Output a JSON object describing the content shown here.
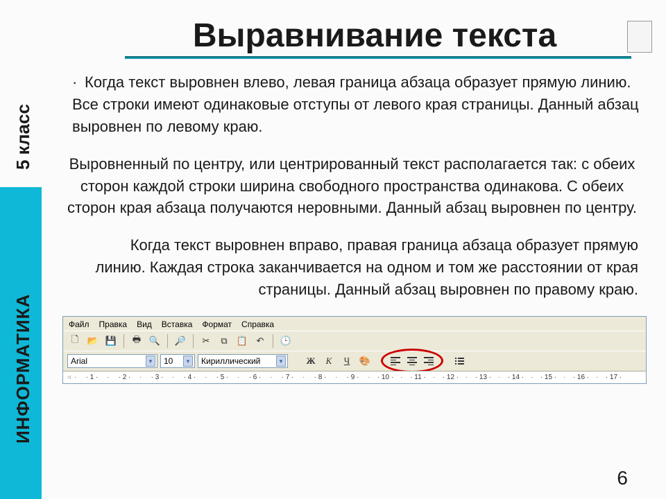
{
  "sidebar": {
    "grade_label": "5 класс",
    "subject_label": "ИНФОРМАТИКА"
  },
  "title": "Выравнивание текста",
  "paragraphs": {
    "left": "Когда текст выровнен влево, левая граница абзаца образует прямую линию. Все строки имеют одинаковые отступы от левого края страницы. Данный абзац выровнен по левому краю.",
    "center": "Выровненный по центру, или центрированный текст располагается так: с обеих сторон каждой строки ширина свободного пространства одинакова. С обеих сторон края абзаца получаются  неровными. Данный абзац выровнен по центру.",
    "right": "Когда текст выровнен вправо, правая граница абзаца образует прямую линию. Каждая строка заканчивается на одном и том же расстоянии от края страницы. Данный абзац выровнен по правому краю."
  },
  "toolbar": {
    "menu": {
      "file": "Файл",
      "edit": "Правка",
      "view": "Вид",
      "insert": "Вставка",
      "format": "Формат",
      "help": "Справка"
    },
    "font_name": "Arial",
    "font_size": "10",
    "script": "Кириллический",
    "bold": "Ж",
    "italic": "К",
    "underline": "Ч"
  },
  "ruler_marks": [
    "1",
    "2",
    "3",
    "4",
    "5",
    "6",
    "7",
    "8",
    "9",
    "10",
    "11",
    "12",
    "13",
    "14",
    "15",
    "16",
    "17"
  ],
  "page_number": "6"
}
